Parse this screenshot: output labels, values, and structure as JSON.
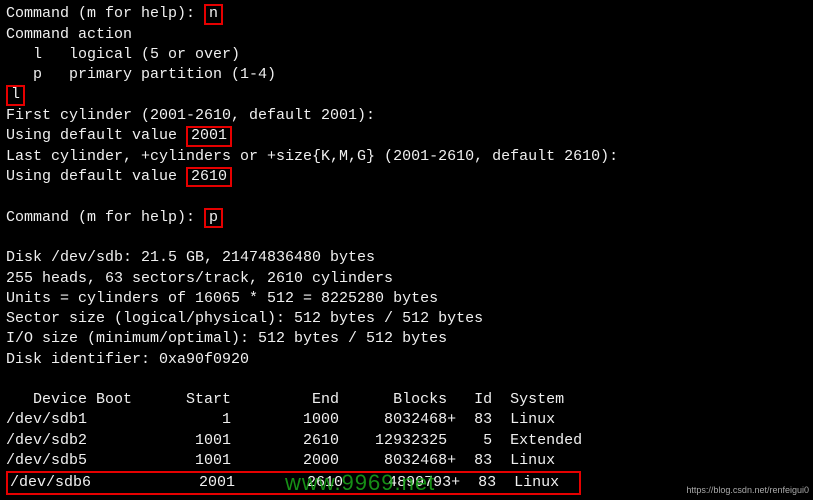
{
  "cmd1": {
    "prompt": "Command (m for help): ",
    "input": "n"
  },
  "action_header": "Command action",
  "action_l": "   l   logical (5 or over)",
  "action_p": "   p   primary partition (1-4)",
  "ltype": "l",
  "first_cyl": "First cylinder (2001-2610, default 2001):",
  "def1_pre": "Using default value ",
  "def1_val": "2001",
  "last_cyl": "Last cylinder, +cylinders or +size{K,M,G} (2001-2610, default 2610):",
  "def2_pre": "Using default value ",
  "def2_val": "2610",
  "cmd2": {
    "prompt": "Command (m for help): ",
    "input": "p"
  },
  "disk": {
    "l1": "Disk /dev/sdb: 21.5 GB, 21474836480 bytes",
    "l2": "255 heads, 63 sectors/track, 2610 cylinders",
    "l3": "Units = cylinders of 16065 * 512 = 8225280 bytes",
    "l4": "Sector size (logical/physical): 512 bytes / 512 bytes",
    "l5": "I/O size (minimum/optimal): 512 bytes / 512 bytes",
    "l6": "Disk identifier: 0xa90f0920"
  },
  "table": {
    "header": "   Device Boot      Start         End      Blocks   Id  System",
    "r1": "/dev/sdb1               1        1000     8032468+  83  Linux",
    "r2": "/dev/sdb2            1001        2610    12932325    5  Extended",
    "r3": "/dev/sdb5            1001        2000     8032468+  83  Linux",
    "r4": "/dev/sdb6            2001        2610     4899793+  83  Linux"
  },
  "watermark": "www.9969.net",
  "source": "https://blog.csdn.net/renfeigui0"
}
